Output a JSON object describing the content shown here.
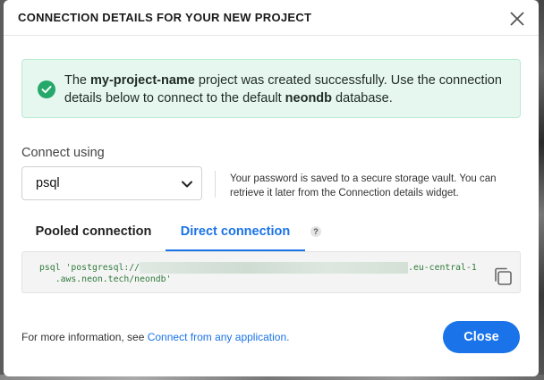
{
  "modal": {
    "title": "CONNECTION DETAILS FOR YOUR NEW PROJECT"
  },
  "alert": {
    "project_name": "my-project-name",
    "text_middle": " project was created successfully. Use the connection details below to connect to the default ",
    "database_name": "neondb",
    "text_end": " database.",
    "icon": "check-circle-icon",
    "color": "#26a86b"
  },
  "connect": {
    "label": "Connect using",
    "selected": "psql",
    "note": "Your password is saved to a secure storage vault. You can retrieve it later from the Connection details widget."
  },
  "tabs": [
    {
      "label": "Pooled connection",
      "active": false
    },
    {
      "label": "Direct connection",
      "active": true
    }
  ],
  "help_glyph": "?",
  "code": {
    "prefix": "psql 'postgresql://",
    "suffix_line1": ".eu-central-1",
    "line2": "   .aws.neon.tech/neondb'"
  },
  "footer": {
    "text": "For more information, see ",
    "link": "Connect from any application."
  },
  "close_button": "Close",
  "colors": {
    "accent": "#1a73e8",
    "success_bg": "#e6f7ef",
    "code_text": "#2f7a3a"
  }
}
